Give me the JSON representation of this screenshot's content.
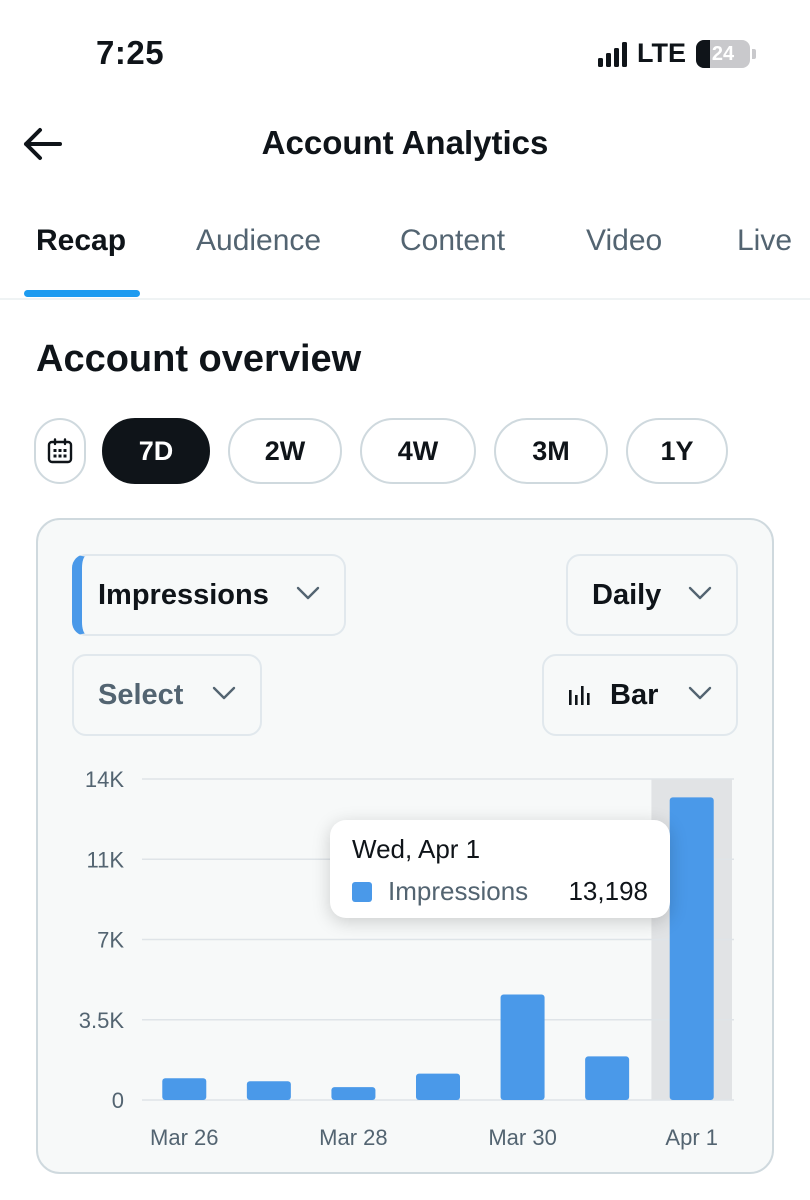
{
  "status_bar": {
    "time": "7:25",
    "network": "LTE",
    "battery": "24"
  },
  "header": {
    "title": "Account Analytics"
  },
  "tabs": [
    {
      "label": "Recap",
      "active": true
    },
    {
      "label": "Audience",
      "active": false
    },
    {
      "label": "Content",
      "active": false
    },
    {
      "label": "Video",
      "active": false
    },
    {
      "label": "Live",
      "active": false
    }
  ],
  "section": {
    "title": "Account overview"
  },
  "periods": [
    {
      "label": "7D",
      "active": true
    },
    {
      "label": "2W",
      "active": false
    },
    {
      "label": "4W",
      "active": false
    },
    {
      "label": "3M",
      "active": false
    },
    {
      "label": "1Y",
      "active": false
    }
  ],
  "controls": {
    "metric": "Impressions",
    "interval": "Daily",
    "compare": "Select",
    "chart_type": "Bar"
  },
  "tooltip": {
    "date": "Wed, Apr 1",
    "series": "Impressions",
    "value": "13,198"
  },
  "colors": {
    "accent": "#1d9bf0",
    "bar": "#4a99e9",
    "highlight": "#e1e3e5"
  },
  "chart_data": {
    "type": "bar",
    "categories": [
      "Mar 26",
      "Mar 27",
      "Mar 28",
      "Mar 29",
      "Mar 30",
      "Mar 31",
      "Apr 1"
    ],
    "x_tick_labels": [
      "Mar 26",
      "Mar 28",
      "Mar 30",
      "Apr 1"
    ],
    "series": [
      {
        "name": "Impressions",
        "values": [
          950,
          820,
          560,
          1150,
          4600,
          1900,
          13198
        ]
      }
    ],
    "y_ticks": [
      "0",
      "3.5K",
      "7K",
      "11K",
      "14K"
    ],
    "y_tick_values": [
      0,
      3500,
      7000,
      10500,
      14000
    ],
    "ylim": [
      0,
      14000
    ],
    "highlighted_category": "Apr 1",
    "grid": true
  }
}
